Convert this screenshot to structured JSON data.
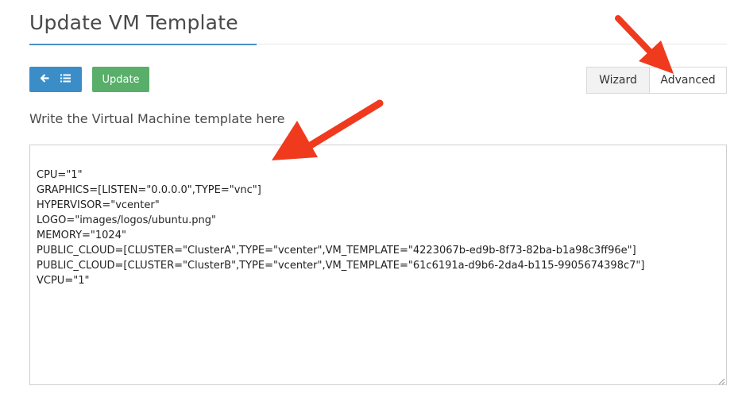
{
  "page": {
    "title": "Update VM Template"
  },
  "toolbar": {
    "back_icon": "arrow-left-icon",
    "list_icon": "list-icon",
    "update_label": "Update"
  },
  "mode_toggle": {
    "wizard_label": "Wizard",
    "advanced_label": "Advanced",
    "active": "Advanced"
  },
  "editor": {
    "label": "Write the Virtual Machine template here",
    "content": "CPU=\"1\"\nGRAPHICS=[LISTEN=\"0.0.0.0\",TYPE=\"vnc\"]\nHYPERVISOR=\"vcenter\"\nLOGO=\"images/logos/ubuntu.png\"\nMEMORY=\"1024\"\nPUBLIC_CLOUD=[CLUSTER=\"ClusterA\",TYPE=\"vcenter\",VM_TEMPLATE=\"4223067b-ed9b-8f73-82ba-b1a98c3ff96e\"]\nPUBLIC_CLOUD=[CLUSTER=\"ClusterB\",TYPE=\"vcenter\",VM_TEMPLATE=\"61c6191a-d9b6-2da4-b115-9905674398c7\"]\nVCPU=\"1\""
  },
  "colors": {
    "primary": "#3b8dc8",
    "success": "#59ae69",
    "annotation_arrow": "#f03a1e"
  }
}
